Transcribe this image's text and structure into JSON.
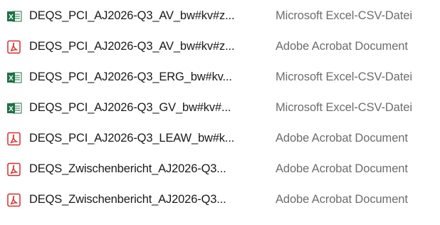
{
  "files": [
    {
      "name": "DEQS_PCI_AJ2026-Q3_AV_bw#kv#z...",
      "type": "Microsoft Excel-CSV-Datei",
      "icon": "excel-csv-icon"
    },
    {
      "name": "DEQS_PCI_AJ2026-Q3_AV_bw#kv#z...",
      "type": "Adobe Acrobat Document",
      "icon": "pdf-icon"
    },
    {
      "name": "DEQS_PCI_AJ2026-Q3_ERG_bw#kv...",
      "type": "Microsoft Excel-CSV-Datei",
      "icon": "excel-csv-icon"
    },
    {
      "name": "DEQS_PCI_AJ2026-Q3_GV_bw#kv#...",
      "type": "Microsoft Excel-CSV-Datei",
      "icon": "excel-csv-icon"
    },
    {
      "name": "DEQS_PCI_AJ2026-Q3_LEAW_bw#k...",
      "type": "Adobe Acrobat Document",
      "icon": "pdf-icon"
    },
    {
      "name": "DEQS_Zwischenbericht_AJ2026-Q3...",
      "type": "Adobe Acrobat Document",
      "icon": "pdf-icon"
    },
    {
      "name": "DEQS_Zwischenbericht_AJ2026-Q3...",
      "type": "Adobe Acrobat Document",
      "icon": "pdf-icon"
    }
  ],
  "colors": {
    "excel_green": "#1e7145",
    "pdf_red": "#d32f2f",
    "type_text": "#6d6d6d"
  }
}
